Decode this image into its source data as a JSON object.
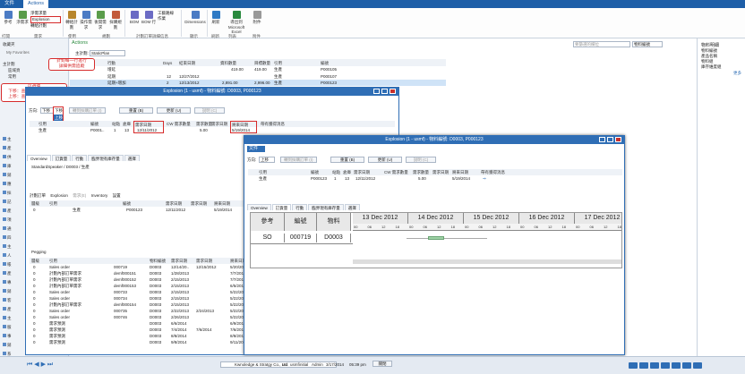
{
  "app": {
    "tabs": [
      "文件",
      "Actions"
    ],
    "active_tab": "Actions"
  },
  "ribbon": {
    "buttons": [
      "參考",
      "淨需求",
      "Explosion",
      "轉給計劃",
      "預測",
      "操作需求",
      "後開需求",
      "採購規劃",
      "BOM",
      "BOM 行",
      "資源",
      "Dimensions",
      "刷新",
      "導出到 Microsoft Excel",
      "附件"
    ],
    "small": [
      "淨需求量",
      "Explosion",
      "轉給計劃"
    ],
    "small2": [
      "工藝路線",
      "作業"
    ],
    "groups": [
      "打開",
      "需求",
      "使用",
      "規劃",
      "計劃訂單詳細信息",
      "顯示",
      "刷新",
      "列表",
      "附件"
    ]
  },
  "nav": {
    "favorites": "收藏夾",
    "my_favorites": "My Favorites",
    "main_plan": "主計劃",
    "links": [
      "區域頁",
      "常用"
    ],
    "modules": [
      "主",
      "產",
      "供",
      "庫",
      "銷",
      "應",
      "採",
      "記",
      "產",
      "項",
      "通",
      "四",
      "主",
      "人",
      "帳",
      "產",
      "專",
      "銷",
      "客",
      "產",
      "主",
      "服",
      "事",
      "銷",
      "系",
      "系"
    ]
  },
  "main": {
    "actions": "Actions",
    "plan_label": "主計劃:",
    "plan_value": "StaticPlan",
    "headers": [
      "行動",
      "Days",
      "結束日期",
      "資料數量",
      "目標數量",
      "引用",
      "編號"
    ],
    "rows": [
      {
        "action": "增延",
        "days": "",
        "end": "",
        "qty": "419.00",
        "target": "419.00",
        "ref": "生產",
        "no": "P000105"
      },
      {
        "action": "延期",
        "days": "12",
        "end": "12/27/2012",
        "qty": "",
        "target": "",
        "ref": "生產",
        "no": "P000107"
      },
      {
        "action": "延期+增加",
        "days": "2",
        "end": "12/13/2012",
        "qty": "2,891.00",
        "target": "2,996.00",
        "ref": "生產",
        "no": "P000123"
      }
    ],
    "search_placeholder": "要篩選的欄位",
    "dropdown": "物料編號"
  },
  "callouts": {
    "c1": "針對每一行進行\n詳細供需追蹤",
    "c2": "可選擇\n下移：查詢下階料供應情況\n上移：查詢上階料需求情況"
  },
  "win1": {
    "title": "Explosion (1 - usmf) - 物料編號: D0003, P000123",
    "dir_label": "方向:",
    "dir_value": "下移",
    "dir_options": [
      "下移",
      "上移"
    ],
    "toolbar": [
      "轉到採購訂單 (I)",
      "重置 (B)",
      "更新 (U)",
      "說明 (C)"
    ],
    "headers": [
      "引用",
      "編號",
      "站點",
      "倉庫",
      "需求日期",
      "CW 需求數量",
      "需求數量",
      "需求日期",
      "將來日期",
      "帶有獲得消息"
    ],
    "row": [
      "生產",
      "P0001..",
      "1",
      "13",
      "12/11/2012",
      "",
      "5.00",
      "",
      "5/19/2014",
      ""
    ],
    "tabs": [
      "Overview",
      "訂貨量",
      "行動",
      "臨界現有庫存量",
      "選擇"
    ],
    "tree": "StandardSpeaker / D0003 / 生產",
    "subtoolbar": [
      "計劃訂單",
      "Explosion",
      "需求(E)",
      "Inventory",
      "設置"
    ],
    "sub_headers": [
      "層級",
      "引用",
      "編號",
      "需求日期",
      "需求日期",
      "將來日期"
    ],
    "sub_row": [
      "0",
      "生產",
      "P000123",
      "12/11/2012",
      "",
      "5/19/2014"
    ],
    "pegging": "Pegging",
    "peg_headers": [
      "層級",
      "引用",
      "物料編號",
      "需求日期",
      "需求日期",
      "將來日期",
      "數量"
    ],
    "peg_rows": [
      [
        "0",
        "Sales order",
        "000719",
        "D0003",
        "12/14/20..",
        "12/15/2012",
        "5/20/2014",
        ""
      ],
      [
        "0",
        "計劃內部訂單需求",
        "demf000151",
        "D0003",
        "1/28/2013",
        "",
        "7/7/2014",
        ""
      ],
      [
        "0",
        "計劃內部訂單需求",
        "demf000152",
        "D0003",
        "2/15/2013",
        "",
        "7/7/2014",
        ""
      ],
      [
        "0",
        "計劃內部訂單需求",
        "demf000153",
        "D0003",
        "2/15/2013",
        "",
        "6/5/2014",
        ""
      ],
      [
        "0",
        "Sales order",
        "000733",
        "D0003",
        "2/15/2013",
        "",
        "5/22/2014",
        ""
      ],
      [
        "0",
        "Sales order",
        "000734",
        "D0003",
        "2/15/2013",
        "",
        "5/22/2014",
        ""
      ],
      [
        "0",
        "計劃內部訂單需求",
        "demf000154",
        "D0003",
        "2/15/2013",
        "",
        "5/22/2014",
        ""
      ],
      [
        "0",
        "Sales order",
        "000735",
        "D0003",
        "2/22/2013",
        "2/24/2013",
        "5/22/2014",
        "-2.00"
      ],
      [
        "0",
        "Sales order",
        "000746",
        "D0003",
        "2/26/2013",
        "",
        "5/22/2014",
        "-200.00"
      ],
      [
        "0",
        "需求預測",
        "",
        "D0003",
        "6/6/2014",
        "",
        "6/9/2014",
        "-822.00"
      ],
      [
        "0",
        "需求預測",
        "",
        "D0003",
        "7/4/2014",
        "7/6/2014",
        "7/6/2014",
        "-849.00"
      ],
      [
        "0",
        "需求預測",
        "",
        "D0003",
        "8/8/2014",
        "",
        "8/8/2014",
        "-822.00"
      ],
      [
        "0",
        "需求預測",
        "",
        "D0003",
        "9/8/2014",
        "",
        "9/11/2014",
        "-822.00"
      ]
    ]
  },
  "win2": {
    "title": "Explosion (1 - usmf) - 物料編號: D0003, P000123",
    "menu": "文件",
    "dir_label": "方向:",
    "dir_value": "上移",
    "toolbar": [
      "轉到採購訂單 (I)",
      "重置 (B)",
      "更新 (U)",
      "說明 (C)"
    ],
    "headers": [
      "引用",
      "編號",
      "站點",
      "倉庫",
      "需求日期",
      "CW 需求數量",
      "需求數量",
      "需求日期",
      "將來日期",
      "帶有獲得消息"
    ],
    "row": [
      "生產",
      "P000123",
      "1",
      "13",
      "12/11/2012",
      "",
      "5.00",
      "",
      "5/19/2014",
      ""
    ],
    "tabs": [
      "Overview",
      "訂貨量",
      "行動",
      "臨界現有庫存量",
      "選擇"
    ],
    "gantt_headers": [
      "參考",
      "編號",
      "物料"
    ],
    "gantt_row": [
      "SO",
      "000719",
      "D0003"
    ],
    "dates": [
      "13 Dec 2012",
      "14 Dec 2012",
      "15 Dec 2012",
      "16 Dec 2012",
      "17 Dec 2012"
    ],
    "ticks": [
      "00",
      "06",
      "12",
      "18"
    ]
  },
  "right_panel": {
    "title": "物料明細",
    "items": [
      "物料編號",
      "產品名稱",
      "物料組",
      "庫存維度組"
    ],
    "more": "更多"
  },
  "status": {
    "user": "Kwnoledge & Stratgy Co., Ltd.",
    "company": "usr",
    "site": "usmf",
    "initial": "initial",
    "role": "Admin",
    "date": "3/17/2014",
    "time": "05:39 pm",
    "close": "關閉"
  }
}
